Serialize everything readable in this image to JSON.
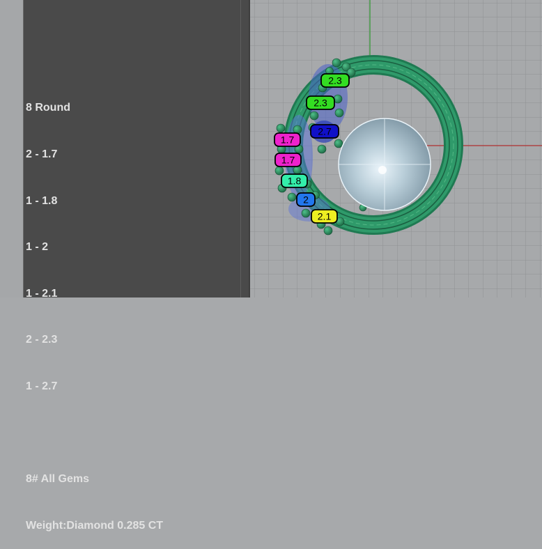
{
  "info_panel": {
    "lines": [
      "8 Round",
      "2 - 1.7",
      "1 - 1.8",
      "1 - 2",
      "1 - 2.1",
      "2 - 2.3",
      "1 - 2.7",
      "",
      "8# All Gems",
      "Weight:Diamond 0.285 CT"
    ]
  },
  "viewport": {
    "grid_color": "#8f9193",
    "background": "#a7a9ab",
    "x_axis_color": "#b03030",
    "y_axis_color": "#2e9a2e",
    "ring_color": "#2f9a6a",
    "pearl_color": "#b8cdd8"
  },
  "gem_labels": [
    {
      "text": "2.3",
      "fill": "#33dd22",
      "text_color": "#000000"
    },
    {
      "text": "2.3",
      "fill": "#33dd22",
      "text_color": "#000000"
    },
    {
      "text": "2.7",
      "fill": "#1010c8",
      "text_color": "#000000"
    },
    {
      "text": "1.7",
      "fill": "#ee22cc",
      "text_color": "#000000"
    },
    {
      "text": "1.7",
      "fill": "#ee22cc",
      "text_color": "#000000"
    },
    {
      "text": "1.8",
      "fill": "#33eeaa",
      "text_color": "#000000"
    },
    {
      "text": "2",
      "fill": "#2277ee",
      "text_color": "#000000"
    },
    {
      "text": "2.1",
      "fill": "#eeee22",
      "text_color": "#000000"
    }
  ]
}
